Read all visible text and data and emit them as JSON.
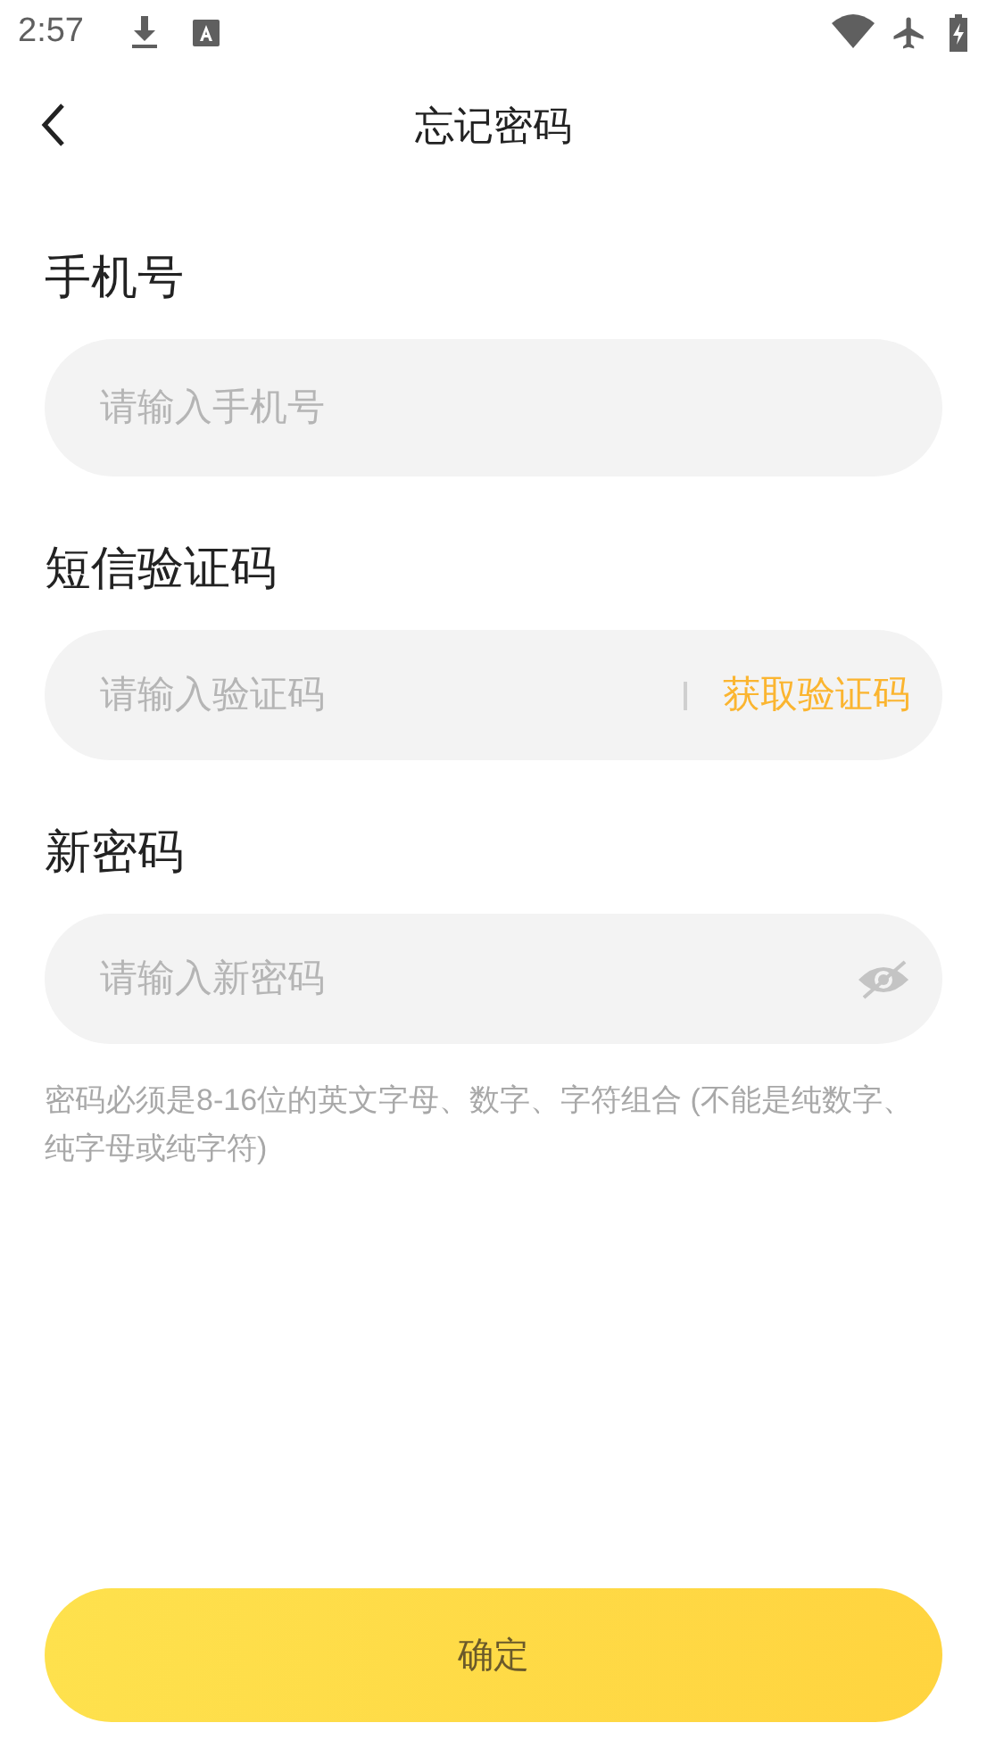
{
  "status_bar": {
    "time": "2:57"
  },
  "header": {
    "title": "忘记密码"
  },
  "form": {
    "fields": [
      {
        "kind": "phone",
        "label": "手机号",
        "placeholder": "请输入手机号"
      },
      {
        "kind": "code",
        "label": "短信验证码",
        "placeholder": "请输入验证码",
        "action": "获取验证码"
      },
      {
        "kind": "password",
        "label": "新密码",
        "placeholder": "请输入新密码",
        "visible": false
      }
    ],
    "hint": "密码必须是8-16位的英文字母、数字、字符组合 (不能是纯数字、纯字母或纯字符)"
  },
  "submit": {
    "label": "确定"
  }
}
